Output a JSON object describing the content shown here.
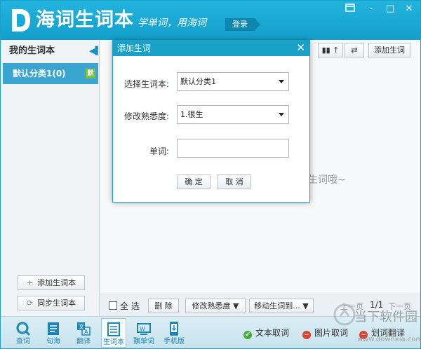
{
  "header": {
    "brand": "海词生词本",
    "slogan": "学单词，用海词",
    "login": "登录",
    "window_controls": [
      "-",
      "□",
      "✕"
    ]
  },
  "sidebar": {
    "title": "我的生词本",
    "category": {
      "label": "默认分类1(0)",
      "badge": "默"
    },
    "add_button": "添加生词本",
    "sync_button": "同步生词本"
  },
  "main": {
    "add_word_button": "添加生词",
    "empty_tip": "生词哦~"
  },
  "bottom_bar": {
    "select_all": "全 选",
    "delete": "删 除",
    "change_familiarity": "修改熟悉度",
    "move_to": "移动生词到...",
    "prev_page": "上一页",
    "page": "1/1",
    "next_page": "下一页"
  },
  "footer": {
    "nav": [
      {
        "label": "查词",
        "icon": "lookup-icon"
      },
      {
        "label": "句海",
        "icon": "sentence-icon"
      },
      {
        "label": "翻译",
        "icon": "translate-icon"
      },
      {
        "label": "生词本",
        "icon": "vocab-book-icon",
        "active": true
      },
      {
        "label": "飘单词",
        "icon": "floating-word-icon"
      },
      {
        "label": "手机版",
        "icon": "mobile-icon"
      }
    ],
    "functions": [
      {
        "label": "文本取词",
        "icon": "check-icon",
        "color": "#4aaa3c"
      },
      {
        "label": "图片取词",
        "icon": "minus-icon",
        "color": "#d9432f"
      },
      {
        "label": "划词翻译",
        "icon": "minus-icon",
        "color": "#d9432f"
      }
    ]
  },
  "dialog": {
    "title": "添加生词",
    "vocab_book_label": "选择生词本:",
    "vocab_book_value": "默认分类1",
    "familiarity_label": "修改熟悉度:",
    "familiarity_value": "1.很生",
    "word_label": "单词:",
    "word_value": "",
    "confirm": "确 定",
    "cancel": "取 消"
  },
  "watermark": {
    "text": "当下软件园",
    "url": "www.downxia.com"
  }
}
